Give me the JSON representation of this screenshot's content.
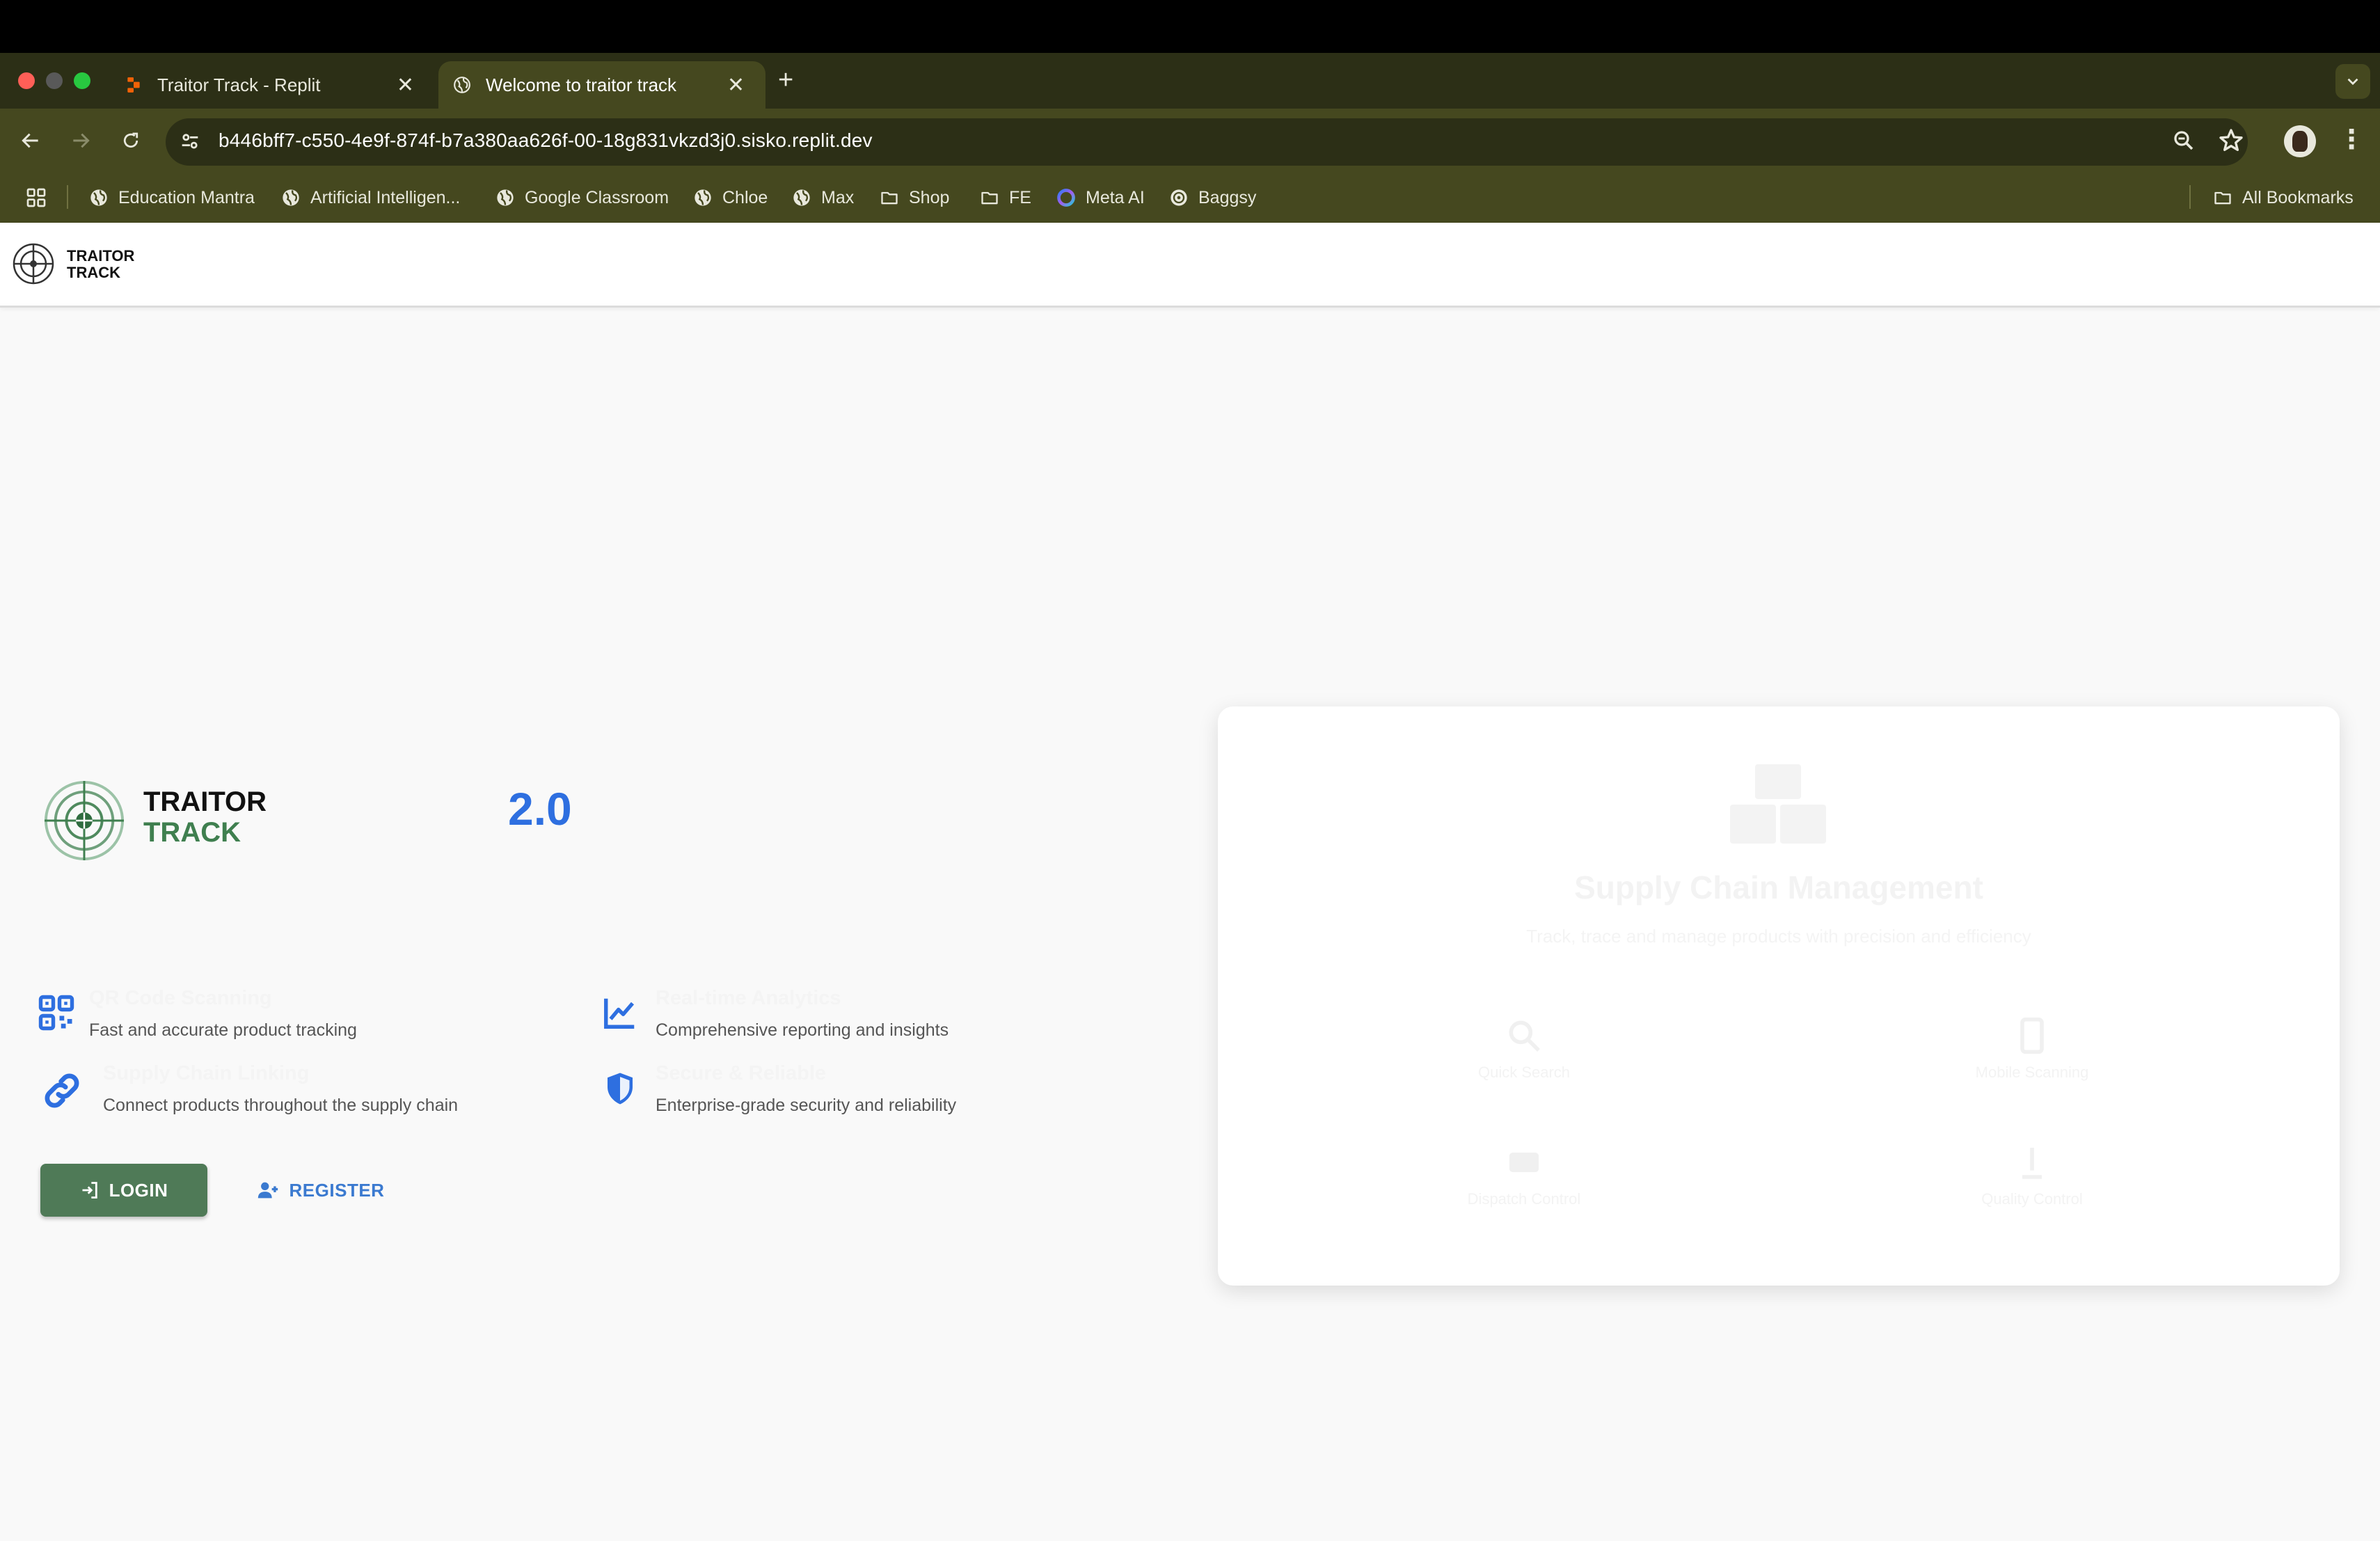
{
  "browser": {
    "tabs": [
      {
        "title": "Traitor Track - Replit",
        "active": false
      },
      {
        "title": "Welcome to traitor track",
        "active": true
      }
    ],
    "new_tab_label": "+",
    "url": "b446bff7-c550-4e9f-874f-b7a380aa626f-00-18g831vkzd3j0.sisko.replit.dev",
    "bookmarks": [
      {
        "label": "Education Mantra",
        "icon": "globe-icon"
      },
      {
        "label": "Artificial Intelligen...",
        "icon": "globe-icon"
      },
      {
        "label": "Google Classroom",
        "icon": "globe-icon"
      },
      {
        "label": "Chloe",
        "icon": "globe-icon"
      },
      {
        "label": "Max",
        "icon": "globe-icon"
      },
      {
        "label": "Shop",
        "icon": "folder-icon"
      },
      {
        "label": "FE",
        "icon": "folder-icon"
      },
      {
        "label": "Meta AI",
        "icon": "meta-ai-icon"
      },
      {
        "label": "Baggsy",
        "icon": "globe-icon"
      }
    ],
    "all_bookmarks": "All Bookmarks"
  },
  "header": {
    "brand_line1": "TRAITOR",
    "brand_line2": "TRACK"
  },
  "hero": {
    "brand_line1": "TRAITOR",
    "brand_line2": "TRACK",
    "version": "2.0",
    "features": [
      {
        "title": "QR Code Scanning",
        "description": "Fast and accurate product tracking",
        "icon": "qr-code-icon"
      },
      {
        "title": "Real-time Analytics",
        "description": "Comprehensive reporting and insights",
        "icon": "analytics-chart-icon"
      },
      {
        "title": "Supply Chain Linking",
        "description": "Connect products throughout the supply chain",
        "icon": "link-icon"
      },
      {
        "title": "Secure & Reliable",
        "description": "Enterprise-grade security and reliability",
        "icon": "shield-icon"
      }
    ],
    "login_label": "LOGIN",
    "register_label": "REGISTER"
  },
  "card": {
    "title": "Supply Chain Management",
    "subtitle": "Track, trace and manage products with precision and efficiency",
    "items": [
      {
        "label": "Quick Search",
        "icon": "search-icon"
      },
      {
        "label": "Mobile Scanning",
        "icon": "mobile-icon"
      },
      {
        "label": "Dispatch Control",
        "icon": "dispatch-icon"
      },
      {
        "label": "Quality Control",
        "icon": "quality-icon"
      }
    ]
  },
  "colors": {
    "accent_blue": "#2e6fe0",
    "brand_green": "#3f7f4f",
    "login_green": "#4f7a57",
    "chrome_dark": "#45481f"
  }
}
